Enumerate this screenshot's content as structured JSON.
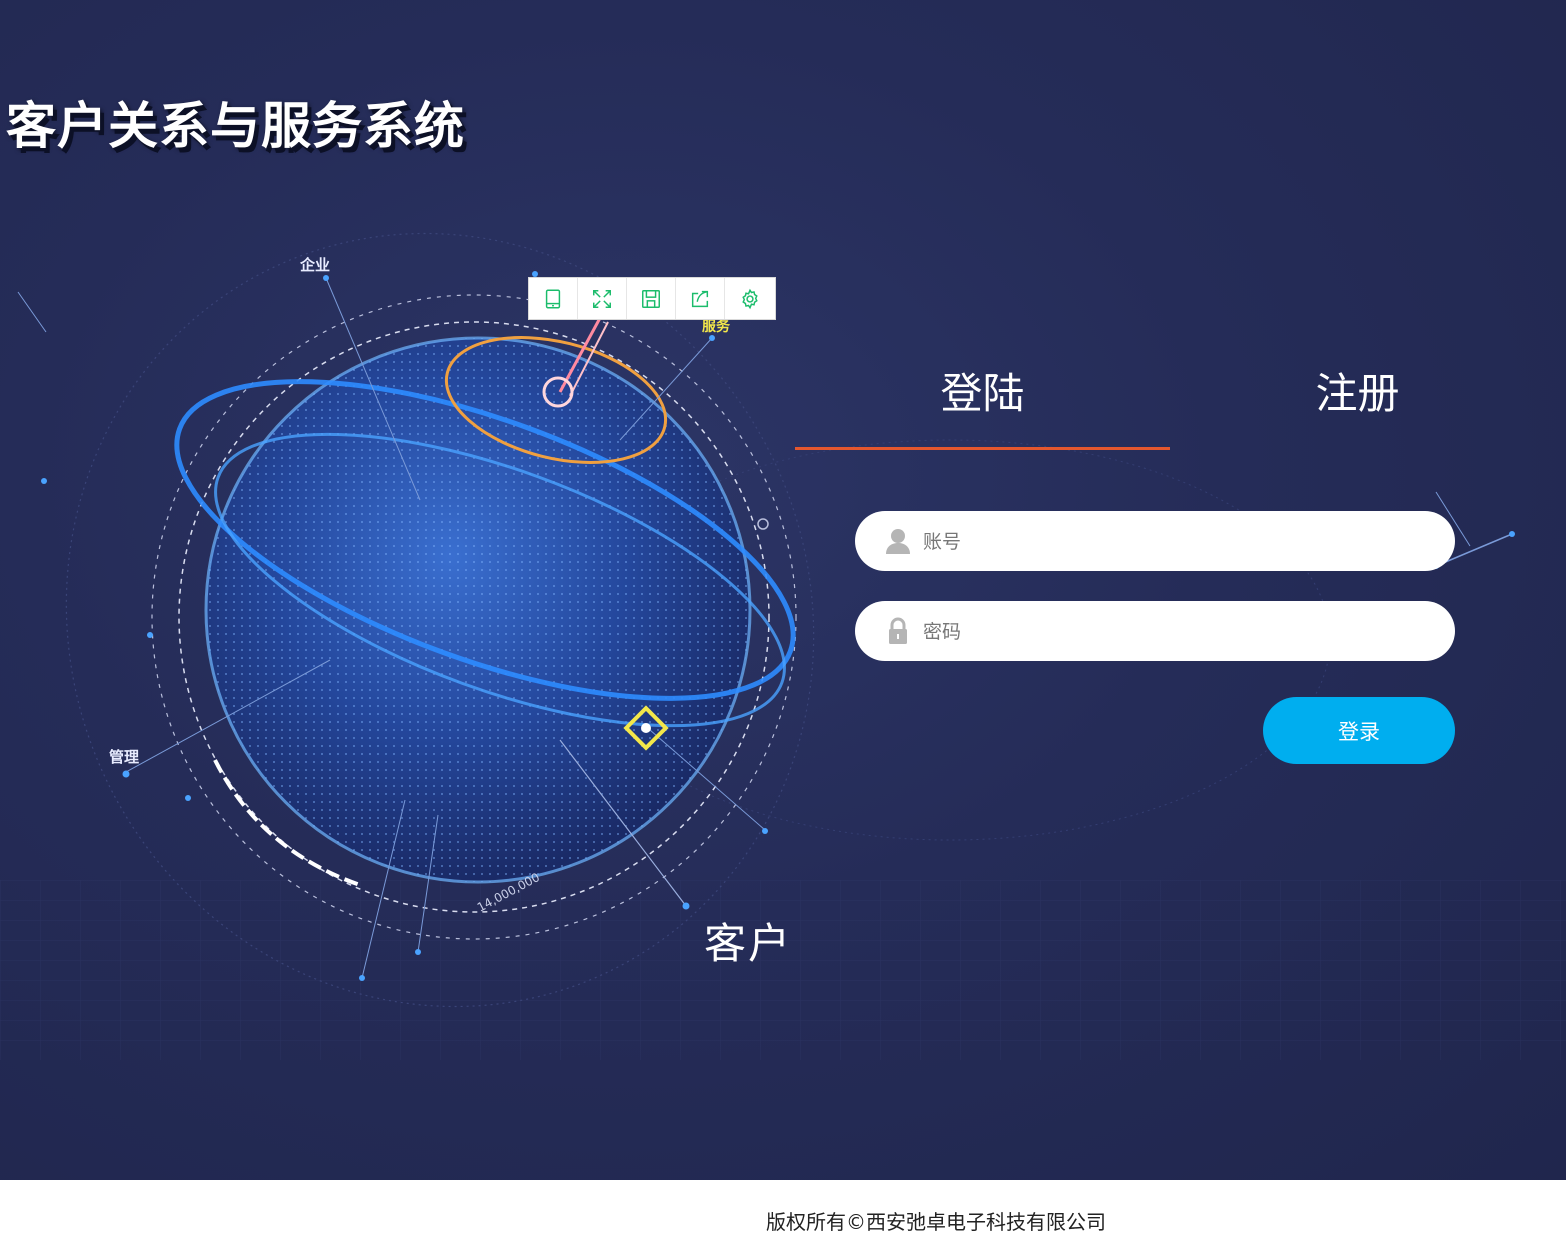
{
  "app": {
    "title": "客户关系与服务系统"
  },
  "globe": {
    "labels": {
      "enterprise": "企业",
      "service": "服务",
      "management": "管理",
      "customer": "客户",
      "orbit_number": "14,000,000"
    }
  },
  "toolbar": {
    "tools": [
      "tablet-icon",
      "fullscreen-icon",
      "save-icon",
      "share-icon",
      "settings-icon"
    ],
    "icon_color": "#1bbc6b"
  },
  "tabs": [
    {
      "label": "登陆",
      "active": true
    },
    {
      "label": "注册",
      "active": false
    }
  ],
  "form": {
    "username": {
      "placeholder": "账号",
      "value": "",
      "icon": "user-icon"
    },
    "password": {
      "placeholder": "密码",
      "value": "",
      "icon": "lock-icon"
    },
    "submit_label": "登录"
  },
  "footer": {
    "copyright": "版权所有©西安弛卓电子科技有限公司"
  },
  "colors": {
    "background": "#252c58",
    "tab_underline": "#e4572e",
    "button": "#00aeef"
  }
}
